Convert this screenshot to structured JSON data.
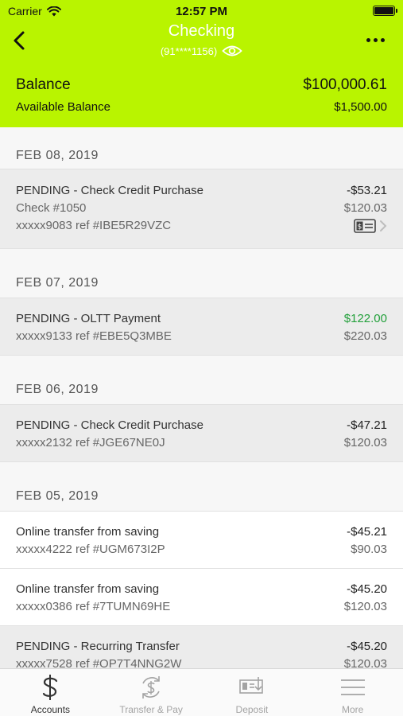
{
  "status_bar": {
    "carrier": "Carrier",
    "time": "12:57 PM"
  },
  "nav": {
    "title": "Checking",
    "account_mask": "(91****1156)"
  },
  "balance": {
    "label": "Balance",
    "value": "$100,000.61",
    "available_label": "Available Balance",
    "available_value": "$1,500.00"
  },
  "groups": [
    {
      "date": "FEB 08, 2019",
      "transactions": [
        {
          "title": "PENDING - Check Credit Purchase",
          "amount": "-$53.21",
          "check": "Check #1050",
          "balance": "$120.03",
          "ref": "xxxxx9083 ref #IBE5R29VZC"
        }
      ]
    },
    {
      "date": "FEB 07, 2019",
      "transactions": [
        {
          "title": "PENDING - OLTT Payment",
          "amount": "$122.00",
          "ref": "xxxxx9133 ref #EBE5Q3MBE",
          "balance": "$220.03"
        }
      ]
    },
    {
      "date": "FEB 06, 2019",
      "transactions": [
        {
          "title": "PENDING - Check Credit Purchase",
          "amount": "-$47.21",
          "ref": "xxxxx2132 ref #JGE67NE0J",
          "balance": "$120.03"
        }
      ]
    },
    {
      "date": "FEB 05, 2019",
      "transactions": [
        {
          "title": "Online transfer from saving",
          "amount": "-$45.21",
          "ref": "xxxxx4222 ref #UGM673I2P",
          "balance": "$90.03"
        },
        {
          "title": "Online transfer from saving",
          "amount": "-$45.20",
          "ref": "xxxxx0386 ref #7TUMN69HE",
          "balance": "$120.03"
        },
        {
          "title": "PENDING - Recurring Transfer",
          "amount": "-$45.20",
          "ref": "xxxxx7528 ref #OP7T4NNG2W",
          "balance": "$120.03"
        }
      ]
    }
  ],
  "tabs": [
    {
      "label": "Accounts",
      "icon": "dollar-icon",
      "active": true
    },
    {
      "label": "Transfer & Pay",
      "icon": "transfer-dollar-icon",
      "active": false
    },
    {
      "label": "Deposit",
      "icon": "check-deposit-icon",
      "active": false
    },
    {
      "label": "More",
      "icon": "menu-icon",
      "active": false
    }
  ],
  "colors": {
    "header_green": "#b9f400",
    "credit_green": "#23a03b",
    "pending_row": "#ececec"
  }
}
